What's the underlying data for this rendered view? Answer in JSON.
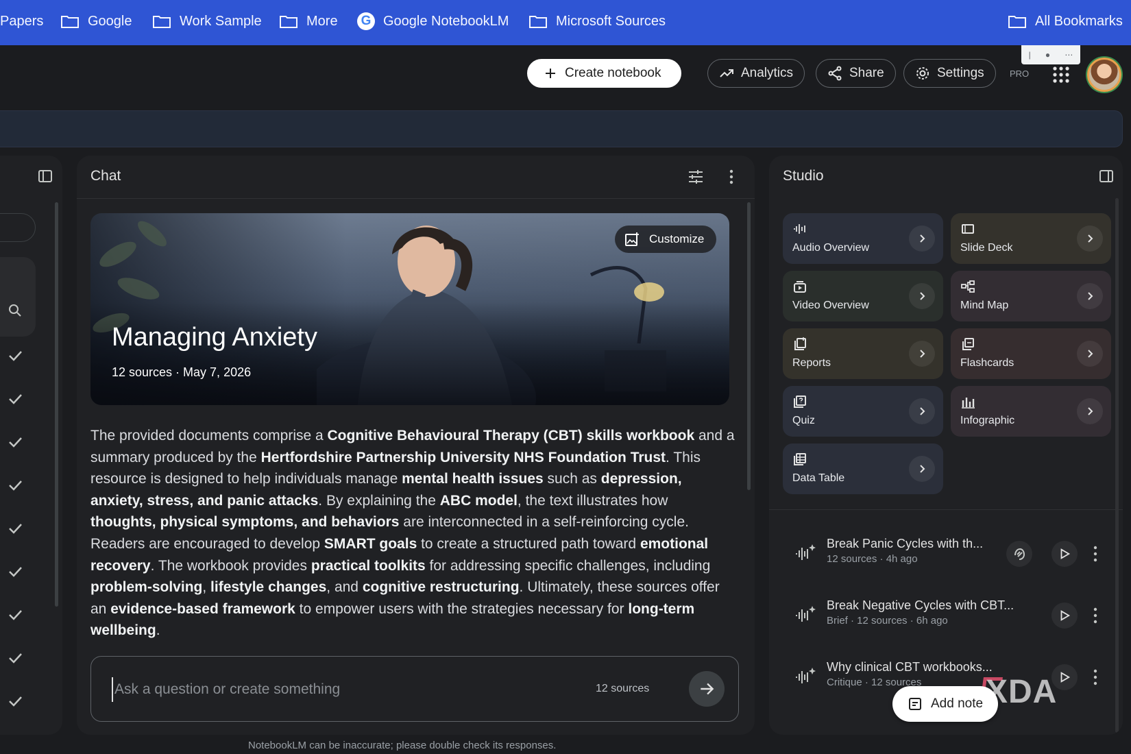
{
  "bookmarks": {
    "items": [
      "Papers",
      "Google",
      "Work Sample",
      "More",
      "Google NotebookLM",
      "Microsoft Sources"
    ],
    "all_label": "All Bookmarks",
    "bar_color": "#2f55d4"
  },
  "header": {
    "create_label": "Create notebook",
    "analytics_label": "Analytics",
    "share_label": "Share",
    "settings_label": "Settings",
    "pro_label": "PRO"
  },
  "chat": {
    "title": "Chat",
    "hero": {
      "title": "Managing Anxiety",
      "subtitle": "12 sources · May 7, 2026",
      "customize_label": "Customize"
    },
    "summary": [
      {
        "t": "The provided documents comprise a "
      },
      {
        "t": "Cognitive Behavioural Therapy (CBT) skills workbook",
        "b": true
      },
      {
        "t": " and a summary produced by the "
      },
      {
        "t": "Hertfordshire Partnership University NHS Foundation Trust",
        "b": true
      },
      {
        "t": ". This resource is designed to help individuals manage "
      },
      {
        "t": "mental health issues",
        "b": true
      },
      {
        "t": " such as "
      },
      {
        "t": "depression, anxiety, stress, and panic attacks",
        "b": true
      },
      {
        "t": ". By explaining the "
      },
      {
        "t": "ABC model",
        "b": true
      },
      {
        "t": ", the text illustrates how "
      },
      {
        "t": "thoughts, physical symptoms, and behaviors",
        "b": true
      },
      {
        "t": " are interconnected in a self-reinforcing cycle. Readers are encouraged to develop "
      },
      {
        "t": "SMART goals",
        "b": true
      },
      {
        "t": " to create a structured path toward "
      },
      {
        "t": "emotional recovery",
        "b": true
      },
      {
        "t": ". The workbook provides "
      },
      {
        "t": "practical toolkits",
        "b": true
      },
      {
        "t": " for addressing specific challenges, including "
      },
      {
        "t": "problem-solving",
        "b": true
      },
      {
        "t": ", "
      },
      {
        "t": "lifestyle changes",
        "b": true
      },
      {
        "t": ", and "
      },
      {
        "t": "cognitive restructuring",
        "b": true
      },
      {
        "t": ". Ultimately, these sources offer an "
      },
      {
        "t": "evidence-based framework",
        "b": true
      },
      {
        "t": " to empower users with the strategies necessary for "
      },
      {
        "t": "long-term wellbeing",
        "b": true
      },
      {
        "t": "."
      }
    ],
    "input_placeholder": "Ask a question or create something",
    "source_count": "12 sources"
  },
  "studio": {
    "title": "Studio",
    "tiles": [
      {
        "label": "Audio Overview",
        "icon": "audio-wave-icon",
        "color": "#2b2f3a"
      },
      {
        "label": "Slide Deck",
        "icon": "slide-deck-icon",
        "color": "#34322c"
      },
      {
        "label": "Video Overview",
        "icon": "video-icon",
        "color": "#2a2f2c"
      },
      {
        "label": "Mind Map",
        "icon": "mind-map-icon",
        "color": "#332d33"
      },
      {
        "label": "Reports",
        "icon": "reports-icon",
        "color": "#34322b"
      },
      {
        "label": "Flashcards",
        "icon": "flashcards-icon",
        "color": "#362d2f"
      },
      {
        "label": "Quiz",
        "icon": "quiz-icon",
        "color": "#2b2f3a"
      },
      {
        "label": "Infographic",
        "icon": "infographic-icon",
        "color": "#332d33"
      },
      {
        "label": "Data Table",
        "icon": "data-table-icon",
        "color": "#2b2f3a"
      }
    ],
    "notes": [
      {
        "title": "Break Panic Cycles with th...",
        "meta": "12 sources · 4h ago"
      },
      {
        "title": "Break Negative Cycles with CBT...",
        "meta": "Brief · 12 sources · 6h ago"
      },
      {
        "title": "Why clinical CBT workbooks...",
        "meta": "Critique · 12 sources"
      }
    ],
    "add_note_label": "Add note"
  },
  "watermark": "XDA",
  "footer": "NotebookLM can be inaccurate; please double check its responses."
}
